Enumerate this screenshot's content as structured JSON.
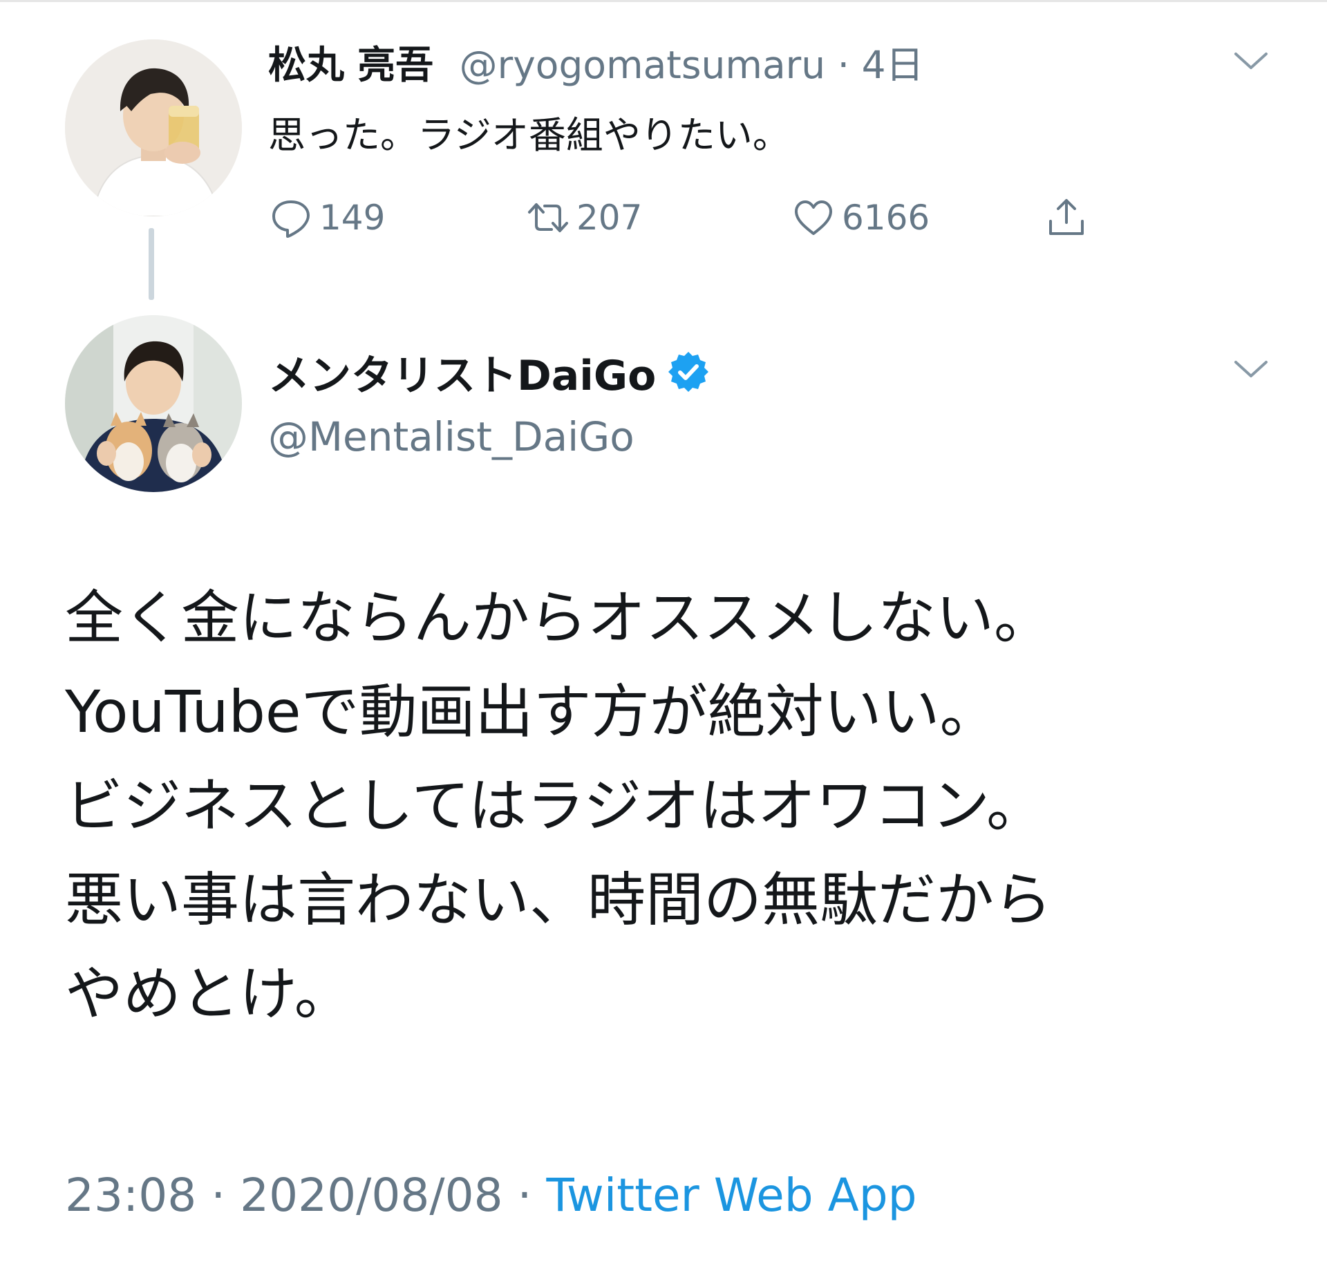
{
  "parent_tweet": {
    "display_name": "松丸 亮吾",
    "handle": "@ryogomatsumaru",
    "separator": "·",
    "time_ago": "4日",
    "text": "思った。ラジオ番組やりたい。",
    "reply_count": "149",
    "retweet_count": "207",
    "like_count": "6166",
    "icons": {
      "reply": "reply-icon",
      "retweet": "retweet-icon",
      "like": "like-icon",
      "share": "share-icon",
      "menu": "chevron-down-icon"
    }
  },
  "main_tweet": {
    "display_name": "メンタリストDaiGo",
    "verified": true,
    "handle": "@Mentalist_DaiGo",
    "text_lines": [
      "全く金にならんからオススメしない。",
      "YouTubeで動画出す方が絶対いい。",
      "ビジネスとしてはラジオはオワコン。",
      "悪い事は言わない、時間の無駄だから",
      "やめとけ。"
    ],
    "time": "23:08",
    "separator": "·",
    "date": "2020/08/08",
    "client": "Twitter Web App",
    "icons": {
      "verified": "verified-badge-icon",
      "menu": "chevron-down-icon"
    }
  },
  "colors": {
    "text_primary": "#14171a",
    "text_secondary": "#657786",
    "link": "#1b95e0",
    "verified": "#1da1f2",
    "thread_line": "#ccd6dd"
  }
}
